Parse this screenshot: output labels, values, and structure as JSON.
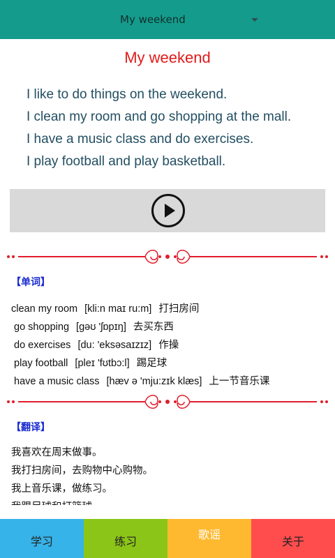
{
  "toolbar": {
    "lesson_selected": "My weekend",
    "dropdown_icon": "caret-down-icon",
    "color": "#149b8c"
  },
  "content": {
    "title": "My weekend",
    "lines": [
      "I like to do things on the weekend.",
      "I clean my room and go shopping at the mall.",
      "I have a music class and do exercises.",
      "I play football and play basketball."
    ]
  },
  "player": {
    "icon": "play-icon"
  },
  "vocabulary": {
    "label": "【单词】",
    "rows": [
      {
        "word": "clean my room",
        "phonetic": "[kli:n maɪ ru:m]",
        "meaning": "打扫房间"
      },
      {
        "word": "go shopping",
        "phonetic": "[gəʊ 'ʃɒpɪŋ]",
        "meaning": "去买东西"
      },
      {
        "word": "do exercises",
        "phonetic": "[du: 'eksəsaɪzɪz]",
        "meaning": "作操"
      },
      {
        "word": "play football",
        "phonetic": "[pleɪ 'fʊtbɔ:l]",
        "meaning": "踢足球"
      },
      {
        "word": "have a music class",
        "phonetic": "[hæv ə 'mju:zɪk klæs]",
        "meaning": "上一节音乐课"
      }
    ]
  },
  "translation": {
    "label": "【翻译】",
    "rows": [
      "我喜欢在周末做事。",
      "我打扫房间，去购物中心购物。",
      "我上音乐课，做练习。",
      "我踢足球和打篮球。"
    ]
  },
  "tabs": [
    {
      "label": "学习",
      "color": "#36b3e8"
    },
    {
      "label": "练习",
      "color": "#8bc518"
    },
    {
      "label": "歌谣",
      "color": "#ffb931"
    },
    {
      "label": "关于",
      "color": "#ff4d4d"
    }
  ]
}
